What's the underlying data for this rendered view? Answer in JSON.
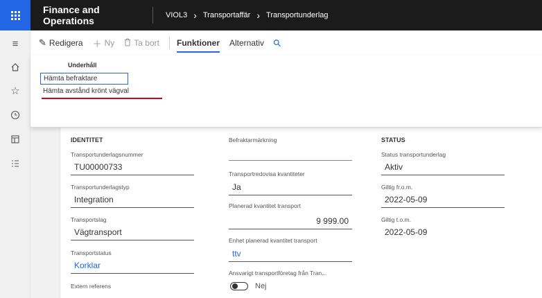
{
  "topbar": {
    "app_title": "Finance and Operations",
    "breadcrumbs": [
      "VIOL3",
      "Transportaffär",
      "Transportunderlag"
    ]
  },
  "leftnav": [
    "hamburger-icon",
    "home-icon",
    "star-icon",
    "clock-icon",
    "workspace-icon",
    "list-icon"
  ],
  "actionpane": {
    "edit": "Redigera",
    "new": "Ny",
    "delete": "Ta bort",
    "tabs": [
      "Funktioner",
      "Alternativ"
    ]
  },
  "flyout": {
    "group": "Underhåll",
    "items": [
      "Hämta befraktare",
      "Hämta avstånd krönt vägval"
    ]
  },
  "form": {
    "col1": {
      "title": "IDENTITET",
      "fields": [
        {
          "label": "Transportunderlagsnummer",
          "value": "TU00000733"
        },
        {
          "label": "Transportunderlagstyp",
          "value": "Integration"
        },
        {
          "label": "Transportslag",
          "value": "Vägtransport"
        },
        {
          "label": "Transportstatus",
          "value": "Korklar"
        },
        {
          "label": "Extern referens",
          "value": ""
        }
      ]
    },
    "col2": {
      "fields": [
        {
          "label": "Befraktarmärkning",
          "value": ""
        },
        {
          "label": "Transportredovisa kvantiteter",
          "value": "Ja"
        },
        {
          "label": "Planerad kvantitet transport",
          "value": "9 999.00"
        },
        {
          "label": "Enhet planerad kvantitet transport",
          "value": "ttv"
        },
        {
          "label": "Ansvarigt transportföretag från Tran...",
          "value": "Nej"
        }
      ]
    },
    "col3": {
      "title": "STATUS",
      "fields": [
        {
          "label": "Status transportunderlag",
          "value": "Aktiv"
        },
        {
          "label": "Giltig fr.o.m.",
          "value": "2022-05-09"
        },
        {
          "label": "Giltig t.o.m.",
          "value": "2022-05-09"
        }
      ]
    }
  },
  "colors": {
    "accent": "#2266e3",
    "topbar": "#1b1b1b",
    "underline_red": "#d0021b"
  }
}
